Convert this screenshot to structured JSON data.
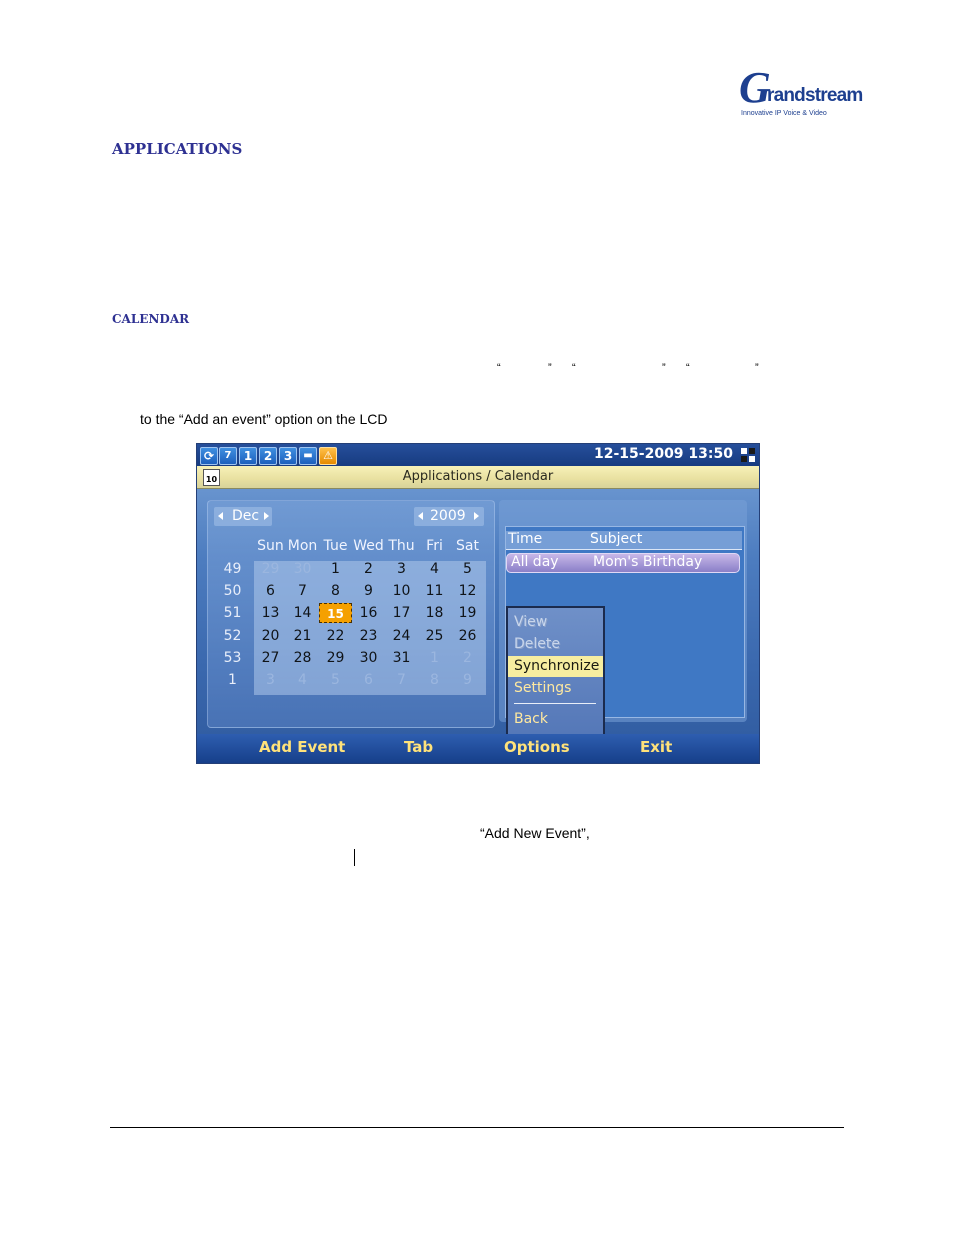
{
  "logo": {
    "brand_initial": "G",
    "brand_rest": "randstream",
    "tagline": "Innovative IP Voice & Video"
  },
  "document": {
    "section_heading": "APPLICATIONS",
    "sub_heading": "CALENDAR",
    "quote_marks": [
      "“",
      "”",
      "“",
      "”",
      "“",
      "”"
    ],
    "instruction": "to the “Add an event” option on the LCD",
    "add_new_event_text": "“Add New Event”,"
  },
  "lcd": {
    "status_bar": {
      "icons": [
        "sync-icon",
        "speaker-icon",
        "line-1-icon",
        "line-2-icon",
        "line-3-icon",
        "folder-icon",
        "warning-icon"
      ],
      "line_numbers": [
        "1",
        "2",
        "3"
      ],
      "speaker_level": "7",
      "datetime": "12-15-2009 13:50"
    },
    "title": "Applications / Calendar",
    "calendar_icon_label": "10",
    "calendar": {
      "month": "Dec",
      "year": "2009",
      "weekday_headers": [
        "Sun",
        "Mon",
        "Tue",
        "Wed",
        "Thu",
        "Fri",
        "Sat"
      ],
      "weeks": [
        {
          "week_no": "49",
          "days": [
            [
              "29",
              "other"
            ],
            [
              "30",
              "other"
            ],
            [
              "1",
              "day"
            ],
            [
              "2",
              "day"
            ],
            [
              "3",
              "day"
            ],
            [
              "4",
              "day"
            ],
            [
              "5",
              "day"
            ]
          ]
        },
        {
          "week_no": "50",
          "days": [
            [
              "6",
              "day"
            ],
            [
              "7",
              "day"
            ],
            [
              "8",
              "day"
            ],
            [
              "9",
              "day"
            ],
            [
              "10",
              "day"
            ],
            [
              "11",
              "day"
            ],
            [
              "12",
              "day"
            ]
          ]
        },
        {
          "week_no": "51",
          "days": [
            [
              "13",
              "day"
            ],
            [
              "14",
              "day"
            ],
            [
              "15",
              "today"
            ],
            [
              "16",
              "day"
            ],
            [
              "17",
              "day"
            ],
            [
              "18",
              "day"
            ],
            [
              "19",
              "day"
            ]
          ]
        },
        {
          "week_no": "52",
          "days": [
            [
              "20",
              "day"
            ],
            [
              "21",
              "day"
            ],
            [
              "22",
              "day"
            ],
            [
              "23",
              "day"
            ],
            [
              "24",
              "day"
            ],
            [
              "25",
              "day"
            ],
            [
              "26",
              "day"
            ]
          ]
        },
        {
          "week_no": "53",
          "days": [
            [
              "27",
              "day"
            ],
            [
              "28",
              "day"
            ],
            [
              "29",
              "day"
            ],
            [
              "30",
              "day"
            ],
            [
              "31",
              "day"
            ],
            [
              "1",
              "other"
            ],
            [
              "2",
              "other"
            ]
          ]
        },
        {
          "week_no": "1",
          "days": [
            [
              "3",
              "other"
            ],
            [
              "4",
              "other"
            ],
            [
              "5",
              "other"
            ],
            [
              "6",
              "other"
            ],
            [
              "7",
              "other"
            ],
            [
              "8",
              "other"
            ],
            [
              "9",
              "other"
            ]
          ]
        }
      ]
    },
    "events": {
      "header_time": "Time",
      "header_subject": "Subject",
      "rows": [
        {
          "time": "All day",
          "subject": "Mom's Birthday"
        }
      ]
    },
    "options_menu": {
      "items": [
        {
          "label": "View",
          "state": "disabled"
        },
        {
          "label": "Delete",
          "state": "disabled"
        },
        {
          "label": "Synchronize",
          "state": "selected"
        },
        {
          "label": "Settings",
          "state": "enabled"
        },
        {
          "label": "Back",
          "state": "enabled"
        }
      ]
    },
    "softkeys": [
      "Add Event",
      "Tab",
      "Options",
      "Exit"
    ]
  },
  "colors": {
    "heading": "#2e3192",
    "softkey_text": "#ffe27a",
    "today_highlight": "#f5a000",
    "menu_selected": "#f7eea0"
  }
}
